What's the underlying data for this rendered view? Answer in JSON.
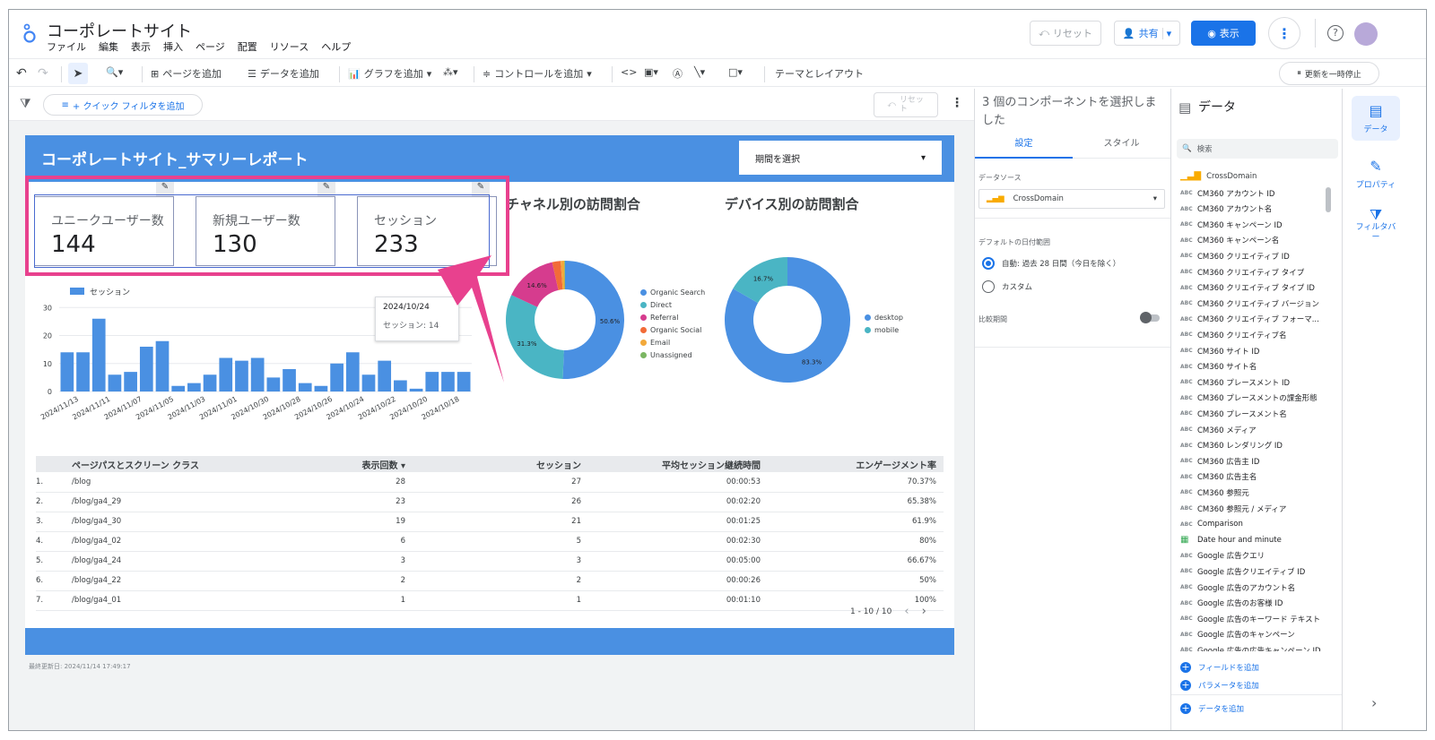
{
  "app": {
    "title": "コーポレートサイト",
    "menus": [
      "ファイル",
      "編集",
      "表示",
      "挿入",
      "ページ",
      "配置",
      "リソース",
      "ヘルプ"
    ],
    "reset_label": "リセット",
    "share_label": "共有",
    "view_label": "表示"
  },
  "toolbar": {
    "add_page": "ページを追加",
    "add_data": "データを追加",
    "add_chart": "グラフを追加",
    "add_control": "コントロールを追加",
    "theme_layout": "テーマとレイアウト",
    "pause_updates": "更新を一時停止"
  },
  "filterbar": {
    "quick_filter": "+ クイック フィルタを追加",
    "reset": "リセット"
  },
  "report": {
    "title": "コーポレートサイト_サマリーレポート",
    "date_picker": "期間を選択",
    "last_updated": "最終更新日: 2024/11/14 17:49:17",
    "kpis": [
      {
        "label": "ユニークユーザー数",
        "value": "144"
      },
      {
        "label": "新規ユーザー数",
        "value": "130"
      },
      {
        "label": "セッション",
        "value": "233"
      }
    ],
    "tooltip": {
      "date": "2024/10/24",
      "text": "セッション: 14"
    }
  },
  "chart_data": [
    {
      "type": "bar",
      "legend": "セッション",
      "tick_labels": [
        "2024/11/13",
        "2024/11/11",
        "2024/11/07",
        "2024/11/05",
        "2024/11/03",
        "2024/11/01",
        "2024/10/30",
        "2024/10/28",
        "2024/10/26",
        "2024/10/24",
        "2024/10/22",
        "2024/10/20",
        "2024/10/18"
      ],
      "values": [
        14,
        14,
        26,
        6,
        7,
        16,
        18,
        2,
        3,
        6,
        12,
        11,
        12,
        5,
        8,
        3,
        2,
        10,
        14,
        6,
        11,
        4,
        1,
        7,
        7,
        7
      ],
      "ylim": [
        0,
        32
      ],
      "yticks": [
        0,
        10,
        20,
        30
      ],
      "color": "#4a90e2"
    },
    {
      "type": "pie",
      "title": "チャネル別の訪問割合",
      "series": [
        {
          "name": "Organic Search",
          "value": 50.6,
          "color": "#4a90e2"
        },
        {
          "name": "Direct",
          "value": 31.3,
          "color": "#4ab5c4"
        },
        {
          "name": "Referral",
          "value": 14.6,
          "color": "#d63c8e"
        },
        {
          "name": "Organic Social",
          "value": 2.3,
          "color": "#f26b38"
        },
        {
          "name": "Email",
          "value": 1.0,
          "color": "#f2a93b"
        },
        {
          "name": "Unassigned",
          "value": 0.2,
          "color": "#7bb662"
        }
      ],
      "slice_labels": [
        "50.6%",
        "31.3%",
        "14.6%"
      ]
    },
    {
      "type": "pie",
      "title": "デバイス別の訪問割合",
      "series": [
        {
          "name": "desktop",
          "value": 83.3,
          "color": "#4a90e2"
        },
        {
          "name": "mobile",
          "value": 16.7,
          "color": "#4ab5c4"
        }
      ],
      "slice_labels": [
        "83.3%",
        "16.7%"
      ]
    },
    {
      "type": "table",
      "columns": [
        "ページパスとスクリーン クラス",
        "表示回数 ▾",
        "セッション",
        "平均セッション継続時間",
        "エンゲージメント率"
      ],
      "rows": [
        [
          "1.",
          "/blog",
          "28",
          "27",
          "00:00:53",
          "70.37%"
        ],
        [
          "2.",
          "/blog/ga4_29",
          "23",
          "26",
          "00:02:20",
          "65.38%"
        ],
        [
          "3.",
          "/blog/ga4_30",
          "19",
          "21",
          "00:01:25",
          "61.9%"
        ],
        [
          "4.",
          "/blog/ga4_02",
          "6",
          "5",
          "00:02:30",
          "80%"
        ],
        [
          "5.",
          "/blog/ga4_24",
          "3",
          "3",
          "00:05:00",
          "66.67%"
        ],
        [
          "6.",
          "/blog/ga4_22",
          "2",
          "2",
          "00:00:26",
          "50%"
        ],
        [
          "7.",
          "/blog/ga4_01",
          "1",
          "1",
          "00:01:10",
          "100%"
        ]
      ],
      "pagination": "1 - 10 / 10"
    }
  ],
  "props_panel": {
    "header": "3 個のコンポーネントを選択しました",
    "tabs": [
      "設定",
      "スタイル"
    ],
    "datasource_label": "データソース",
    "datasource_value": "CrossDomain",
    "date_range_label": "デフォルトの日付範囲",
    "auto_option": "自動: 過去 28 日間（今日を除く）",
    "custom_option": "カスタム",
    "compare_label": "比較期間"
  },
  "data_panel": {
    "title": "データ",
    "search_placeholder": "検索",
    "source": "CrossDomain",
    "fields": [
      "CM360 アカウント ID",
      "CM360 アカウント名",
      "CM360 キャンペーン ID",
      "CM360 キャンペーン名",
      "CM360 クリエイティブ ID",
      "CM360 クリエイティブ タイプ",
      "CM360 クリエイティブ タイプ ID",
      "CM360 クリエイティブ バージョン",
      "CM360 クリエイティブ フォーマ...",
      "CM360 クリエイティブ名",
      "CM360 サイト ID",
      "CM360 サイト名",
      "CM360 プレースメント ID",
      "CM360 プレースメントの課金形態",
      "CM360 プレースメント名",
      "CM360 メディア",
      "CM360 レンダリング ID",
      "CM360 広告主 ID",
      "CM360 広告主名",
      "CM360 参照元",
      "CM360 参照元 / メディア",
      "Comparison",
      "Date hour and minute",
      "Google 広告クエリ",
      "Google 広告クリエイティブ ID",
      "Google 広告のアカウント名",
      "Google 広告のお客様 ID",
      "Google 広告のキーワード テキスト",
      "Google 広告のキャンペーン",
      "Google 広告の広告キャンペーン ID"
    ],
    "add_field": "フィールドを追加",
    "add_param": "パラメータを追加",
    "add_data": "データを追加"
  },
  "rail": {
    "data": "データ",
    "property": "プロパティ",
    "filter": "フィルタバー"
  },
  "colors": {
    "accent": "#4a90e2",
    "highlight": "#e8418e",
    "primary_button": "#1a73e8"
  }
}
